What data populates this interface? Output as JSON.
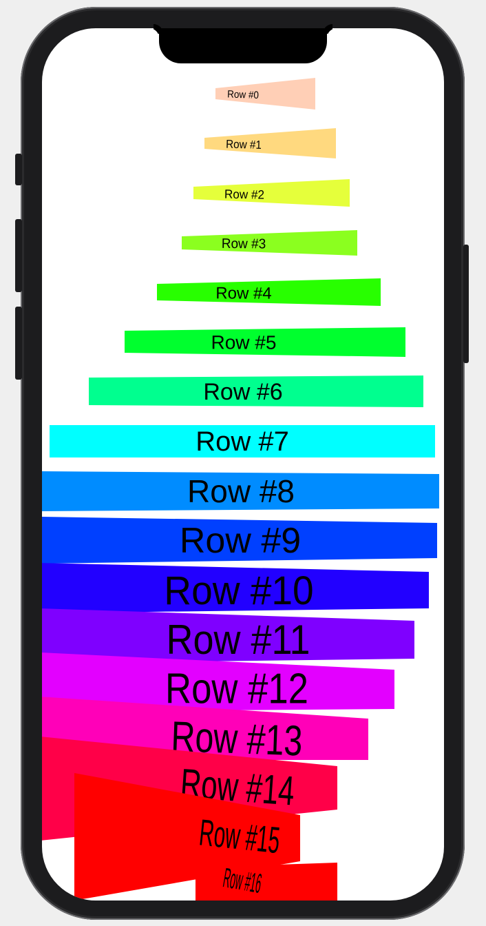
{
  "rows": [
    {
      "label": "Row #0",
      "color": "#ffcfb6"
    },
    {
      "label": "Row #1",
      "color": "#ffd97f"
    },
    {
      "label": "Row #2",
      "color": "#e5ff3b"
    },
    {
      "label": "Row #3",
      "color": "#8bff1f"
    },
    {
      "label": "Row #4",
      "color": "#28ff00"
    },
    {
      "label": "Row #5",
      "color": "#00ff2e"
    },
    {
      "label": "Row #6",
      "color": "#00ff8f"
    },
    {
      "label": "Row #7",
      "color": "#00ffff"
    },
    {
      "label": "Row #8",
      "color": "#008cff"
    },
    {
      "label": "Row #9",
      "color": "#0040ff"
    },
    {
      "label": "Row #10",
      "color": "#2200ff"
    },
    {
      "label": "Row #11",
      "color": "#7f00ff"
    },
    {
      "label": "Row #12",
      "color": "#e300ff"
    },
    {
      "label": "Row #13",
      "color": "#ff00b8"
    },
    {
      "label": "Row #14",
      "color": "#ff0048"
    },
    {
      "label": "Row #15",
      "color": "#ff0000"
    },
    {
      "label": "Row #16",
      "color": "#ff0000"
    }
  ]
}
